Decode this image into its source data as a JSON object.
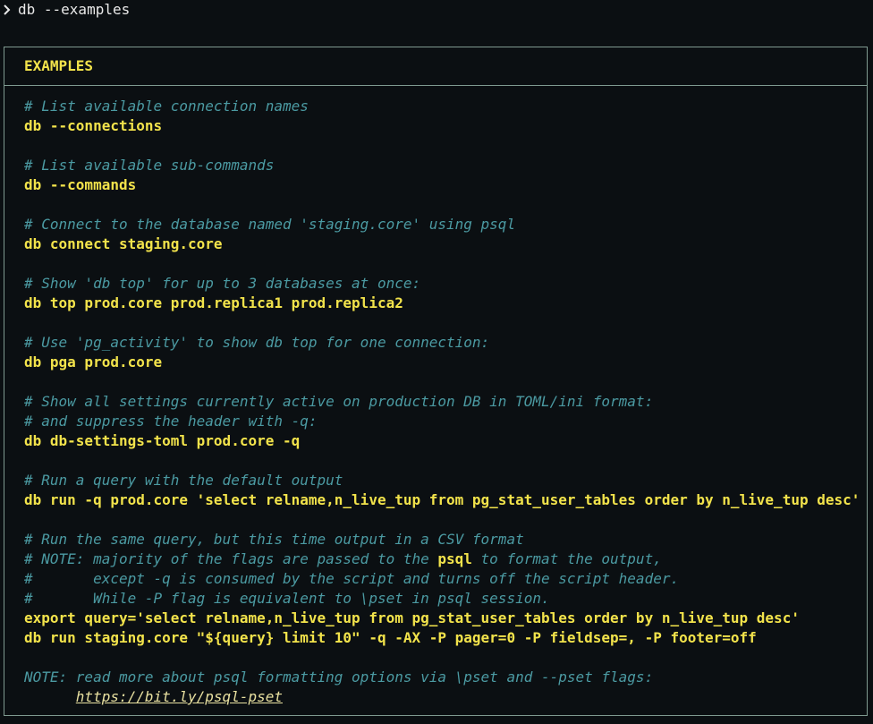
{
  "terminal": {
    "prompt_symbol_icon": "chevron-right-icon",
    "command": "db --examples"
  },
  "panel": {
    "title": "EXAMPLES",
    "blocks": [
      {
        "comment": "# List available connection names",
        "command": "db --connections"
      },
      {
        "comment": "# List available sub-commands",
        "command": "db --commands"
      },
      {
        "comment": "# Connect to the database named 'staging.core' using psql",
        "command": "db connect staging.core"
      },
      {
        "comment": "# Show 'db top' for up to 3 databases at once:",
        "command": "db top prod.core prod.replica1 prod.replica2"
      },
      {
        "comment": "# Use 'pg_activity' to show db top for one connection:",
        "command": "db pga prod.core"
      },
      {
        "comment_1": "# Show all settings currently active on production DB in TOML/ini format:",
        "comment_2": "# and suppress the header with -q:",
        "command": "db db-settings-toml prod.core -q"
      },
      {
        "comment": "# Run a query with the default output",
        "command": "db run -q prod.core 'select relname,n_live_tup from pg_stat_user_tables order by n_live_tup desc'"
      },
      {
        "comment_1": "# Run the same query, but this time output in a CSV format",
        "comment_2_prefix": "# NOTE: majority of the flags are passed to the ",
        "comment_2_keyword": "psql",
        "comment_2_suffix": " to format the output,",
        "comment_3": "#       except -q is consumed by the script and turns off the script header.",
        "comment_4": "#       While -P flag is equivalent to \\pset in psql session.",
        "command_1": "export query='select relname,n_live_tup from pg_stat_user_tables order by n_live_tup desc'",
        "command_2": "db run staging.core \"${query} limit 10\" -q -AX -P pager=0 -P fieldsep=, -P footer=off"
      }
    ],
    "note": {
      "text": "NOTE: read more about psql formatting options via \\pset and --pset flags:",
      "link_indent": "      ",
      "link": "https://bit.ly/psql-pset"
    }
  },
  "colors": {
    "background": "#0b0f12",
    "comment": "#4b9aa2",
    "command": "#f2e34b",
    "border": "#7f9a90"
  }
}
